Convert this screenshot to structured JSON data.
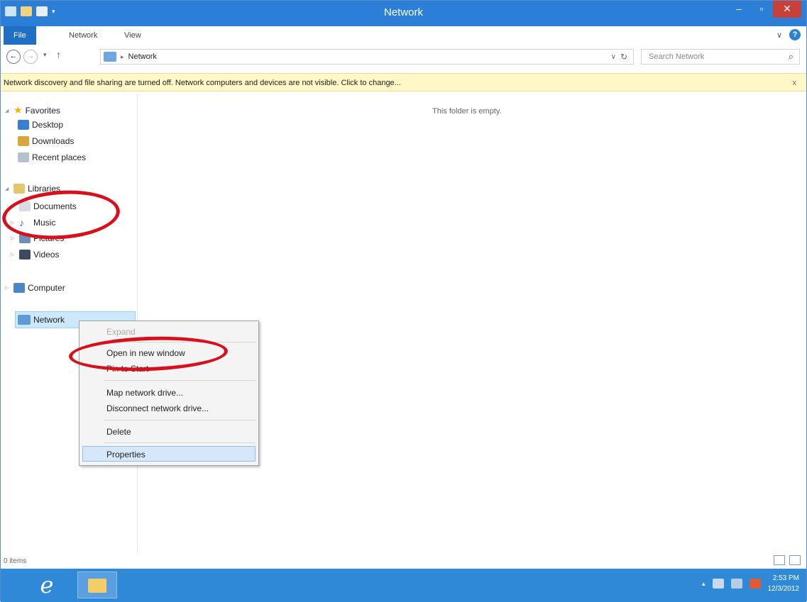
{
  "window": {
    "title": "Network",
    "minimize_glyph": "–",
    "maximize_glyph": "▫",
    "close_glyph": "✕"
  },
  "ribbon": {
    "tabs": [
      "File",
      "Network",
      "View"
    ],
    "expand_glyph": "∨",
    "help_glyph": "?"
  },
  "address": {
    "back_glyph": "←",
    "forward_glyph": "→",
    "recent_glyph": "▾",
    "up_glyph": "↑",
    "separator": "▸",
    "location": "Network",
    "dropdown_glyph": "∨",
    "refresh_glyph": "↻",
    "search_placeholder": "Search Network",
    "search_glyph": "⌕"
  },
  "infobar": {
    "message": "Network discovery and file sharing are turned off. Network computers and devices are not visible. Click to change...",
    "close_glyph": "x"
  },
  "navpane": {
    "favorites": {
      "label": "Favorites",
      "items": [
        "Desktop",
        "Downloads",
        "Recent places"
      ]
    },
    "libraries": {
      "label": "Libraries",
      "items": [
        "Documents",
        "Music",
        "Pictures",
        "Videos"
      ]
    },
    "computer": "Computer",
    "network": "Network"
  },
  "content": {
    "empty_message": "This folder is empty."
  },
  "context_menu": {
    "items": [
      {
        "label": "Expand",
        "disabled": true
      },
      {
        "label": "Open in new window"
      },
      {
        "label": "Pin to Start"
      },
      {
        "label": "Map network drive..."
      },
      {
        "label": "Disconnect network drive..."
      },
      {
        "label": "Delete"
      },
      {
        "label": "Properties",
        "highlighted": true
      }
    ]
  },
  "statusbar": {
    "item_count": "0 items"
  },
  "taskbar": {
    "ie_glyph": "e",
    "tray_chevron": "▴",
    "time": "2:53 PM",
    "date": "12/3/2012"
  },
  "colors": {
    "titlebar": "#2b7fd6",
    "infobar": "#fff7c6",
    "annotation_ring": "#d8101c",
    "taskbar": "#2f89d6"
  }
}
